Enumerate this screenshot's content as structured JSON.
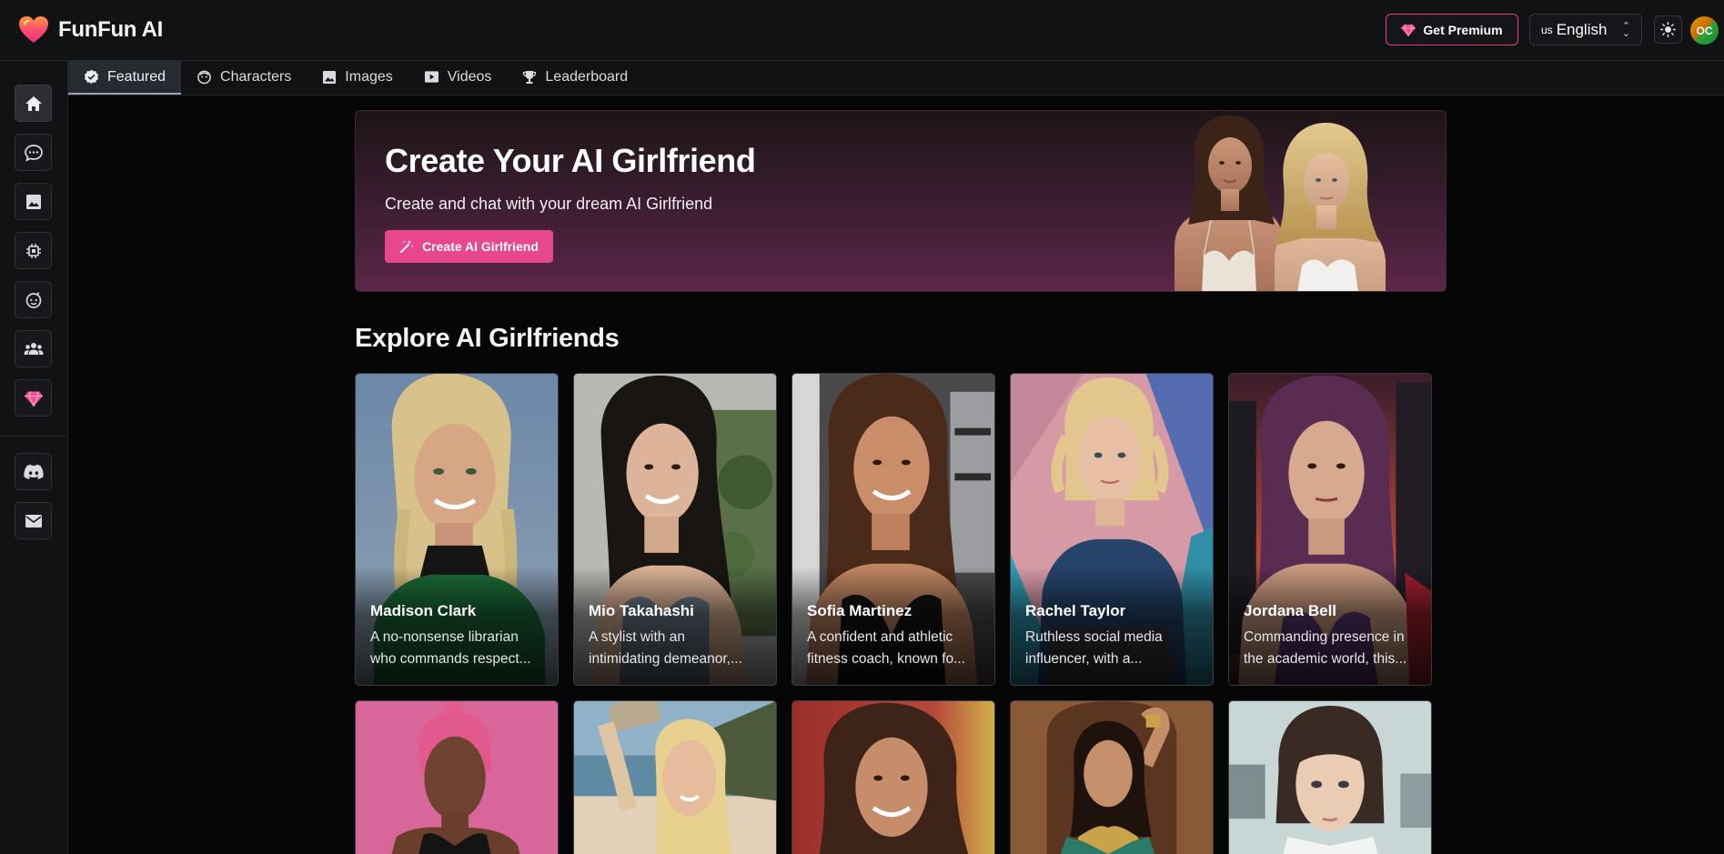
{
  "app": {
    "name": "FunFun AI"
  },
  "header": {
    "premium_label": "Get Premium",
    "language_flag": "us",
    "language_label": "English",
    "avatar_initials": "OC"
  },
  "tabs": [
    {
      "label": "Featured",
      "icon": "badge-check-icon",
      "active": true
    },
    {
      "label": "Characters",
      "icon": "face-icon"
    },
    {
      "label": "Images",
      "icon": "image-icon"
    },
    {
      "label": "Videos",
      "icon": "video-icon"
    },
    {
      "label": "Leaderboard",
      "icon": "trophy-icon"
    }
  ],
  "sidebar": {
    "items": [
      {
        "icon": "home-icon",
        "active": true
      },
      {
        "icon": "chat-icon"
      },
      {
        "icon": "image-icon"
      },
      {
        "icon": "chip-icon"
      },
      {
        "icon": "character-face-icon"
      },
      {
        "icon": "community-icon"
      },
      {
        "icon": "diamond-icon"
      },
      {
        "icon": "discord-icon"
      },
      {
        "icon": "mail-icon"
      }
    ]
  },
  "banner": {
    "title": "Create Your AI Girlfriend",
    "subtitle": "Create and chat with your dream AI Girlfriend",
    "button_label": "Create AI Girlfriend"
  },
  "explore": {
    "title": "Explore AI Girlfriends",
    "cards": [
      {
        "name": "Madison Clark",
        "desc_line1": "A no-nonsense librarian",
        "desc_line2": "who commands respect..."
      },
      {
        "name": "Mio Takahashi",
        "desc_line1": "A stylist with an",
        "desc_line2": "intimidating demeanor,..."
      },
      {
        "name": "Sofia Martinez",
        "desc_line1": "A confident and athletic",
        "desc_line2": "fitness coach, known fo..."
      },
      {
        "name": "Rachel Taylor",
        "desc_line1": "Ruthless social media",
        "desc_line2": "influencer, with a..."
      },
      {
        "name": "Jordana Bell",
        "desc_line1": "Commanding presence in",
        "desc_line2": "the academic world, this..."
      }
    ]
  },
  "colors": {
    "accent_pink": "#e8478e",
    "background": "#060607",
    "panel": "#111214"
  }
}
